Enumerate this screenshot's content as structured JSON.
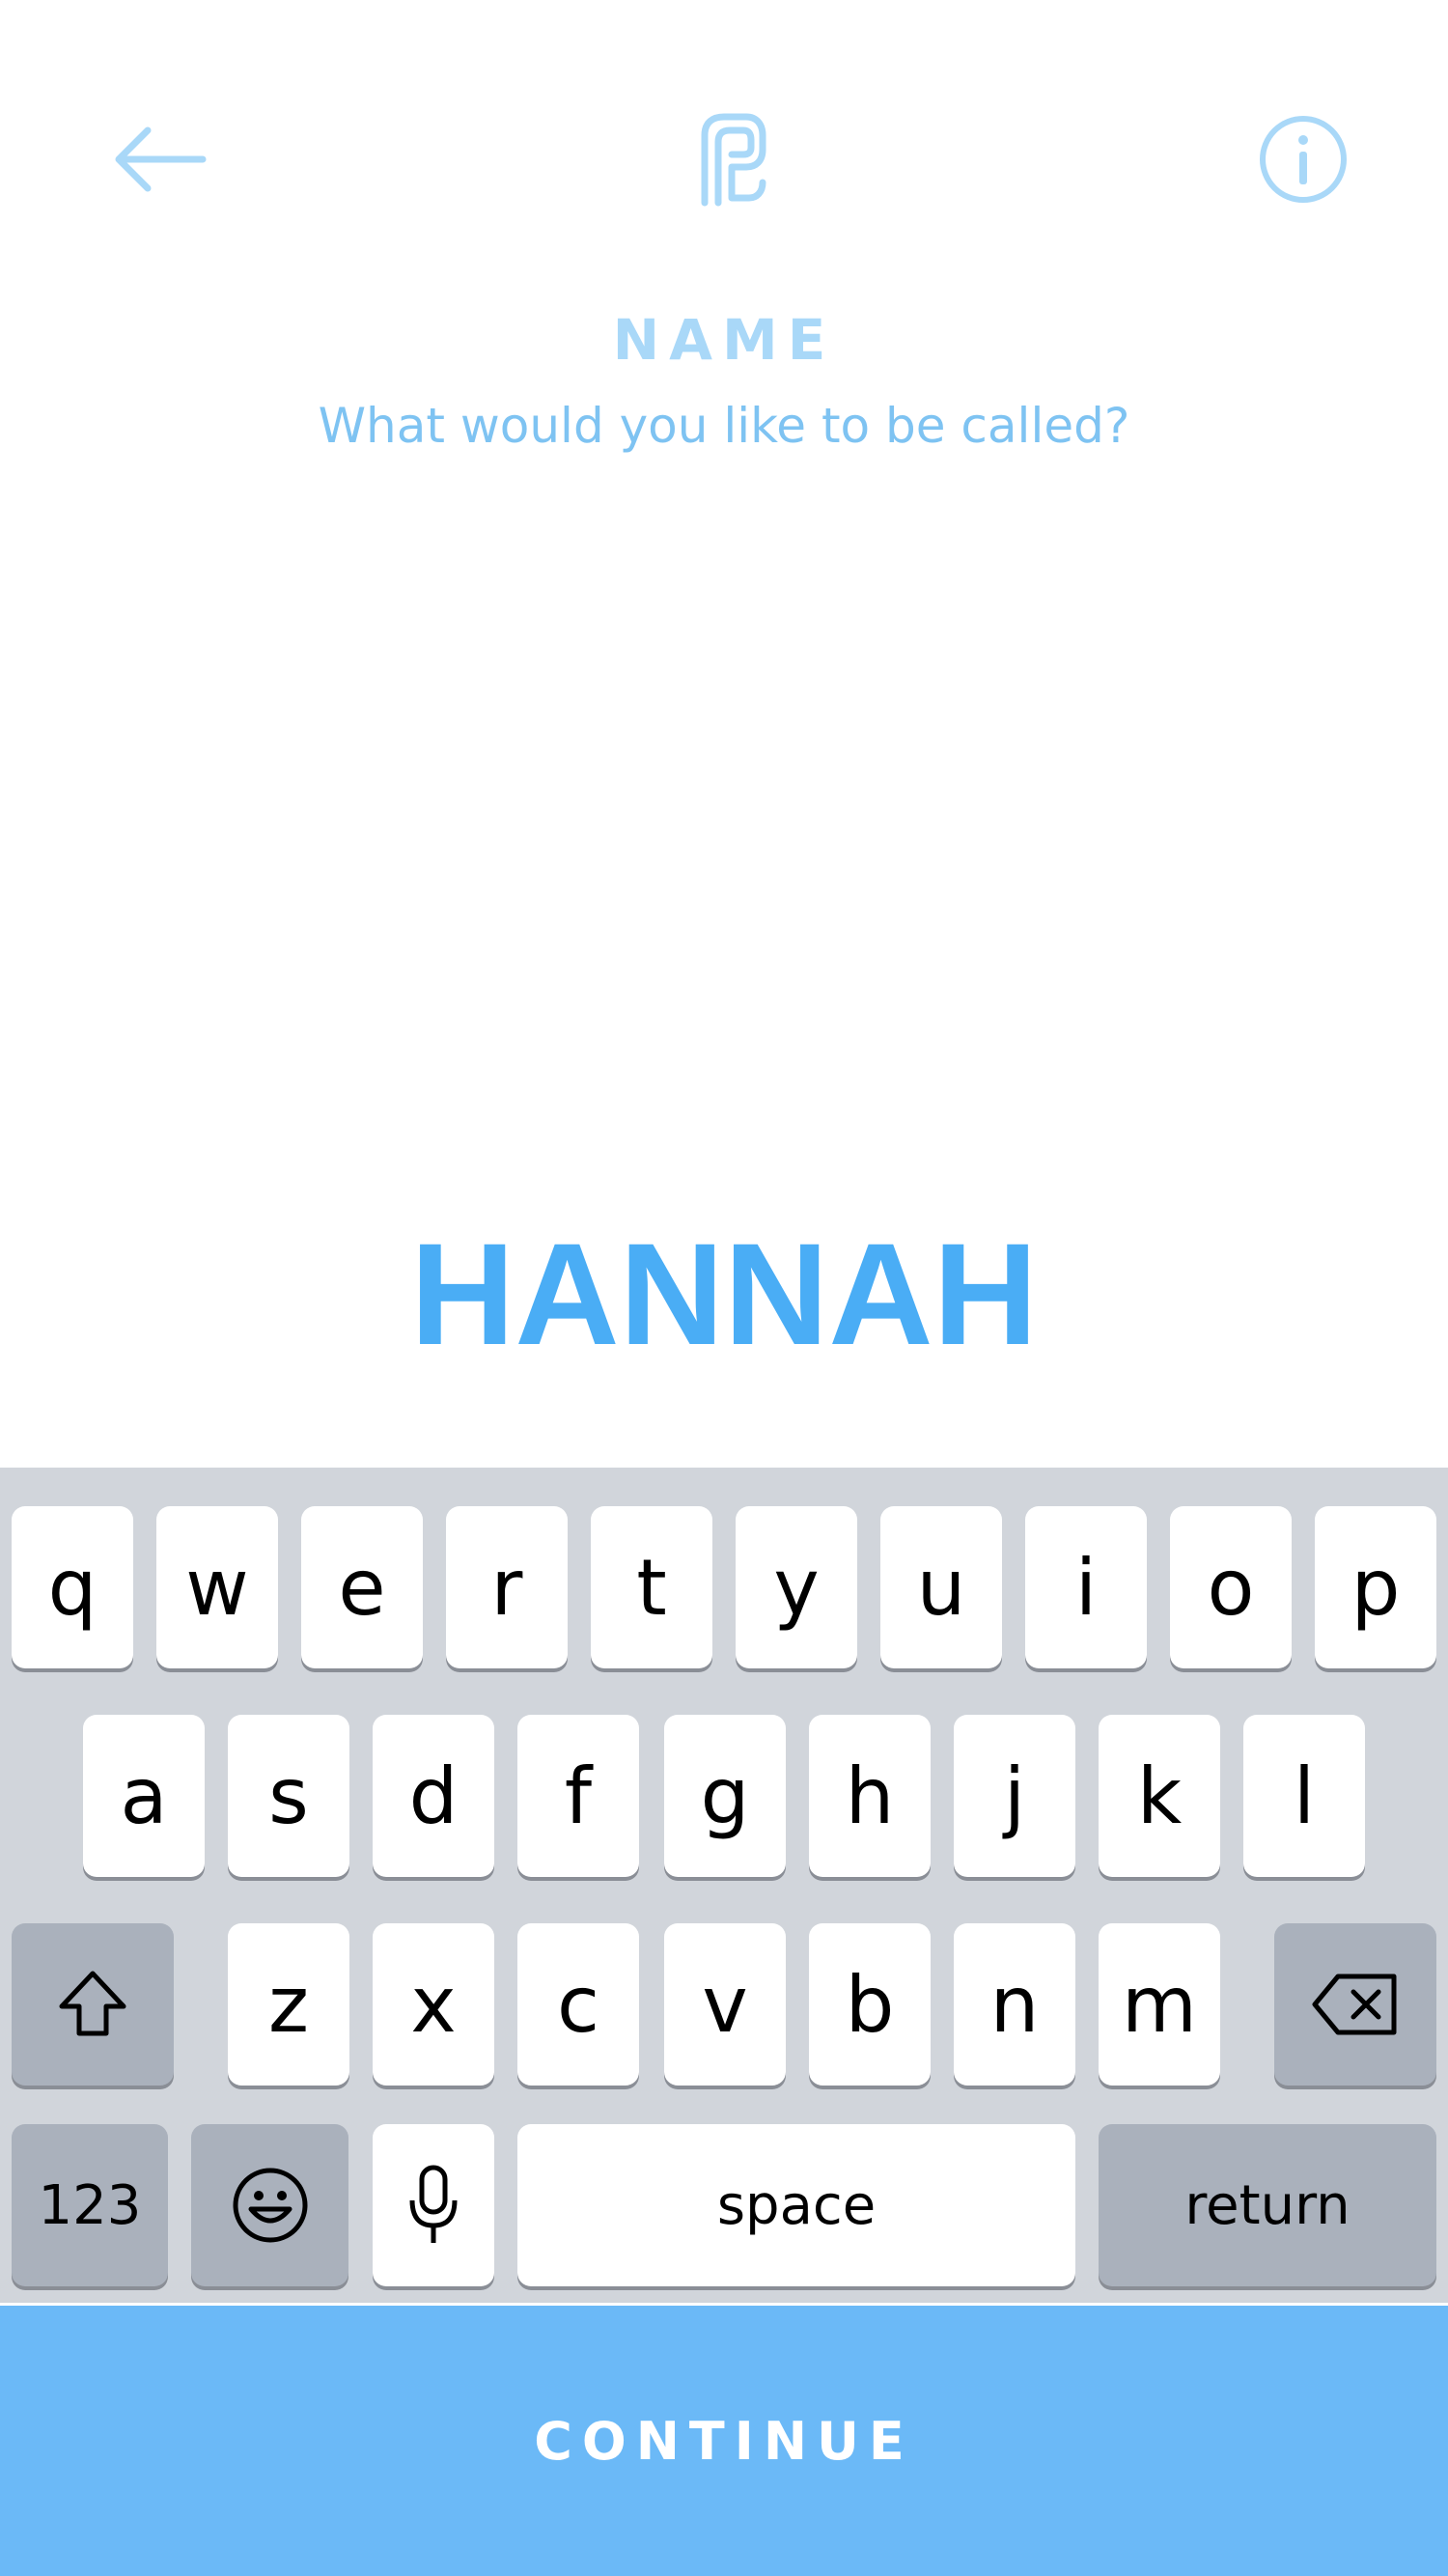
{
  "header": {
    "back_icon": "arrow-left-icon",
    "logo_icon": "planned-parenthood-logo-icon",
    "info_icon": "info-circle-icon",
    "icon_color": "#a9d8f8"
  },
  "page": {
    "title": "NAME",
    "subtitle": "What would you like to be called?"
  },
  "name_field": {
    "value": "HANNAH",
    "color": "#4aadf5"
  },
  "keyboard": {
    "row1": [
      "q",
      "w",
      "e",
      "r",
      "t",
      "y",
      "u",
      "i",
      "o",
      "p"
    ],
    "row2": [
      "a",
      "s",
      "d",
      "f",
      "g",
      "h",
      "j",
      "k",
      "l"
    ],
    "row3": [
      "z",
      "x",
      "c",
      "v",
      "b",
      "n",
      "m"
    ],
    "shift_icon": "shift-arrow-icon",
    "backspace_icon": "backspace-icon",
    "numbers_label": "123",
    "emoji_icon": "emoji-smiley-icon",
    "mic_icon": "microphone-icon",
    "space_label": "space",
    "return_label": "return"
  },
  "footer": {
    "continue_label": "CONTINUE",
    "color": "#6bb9f7"
  }
}
